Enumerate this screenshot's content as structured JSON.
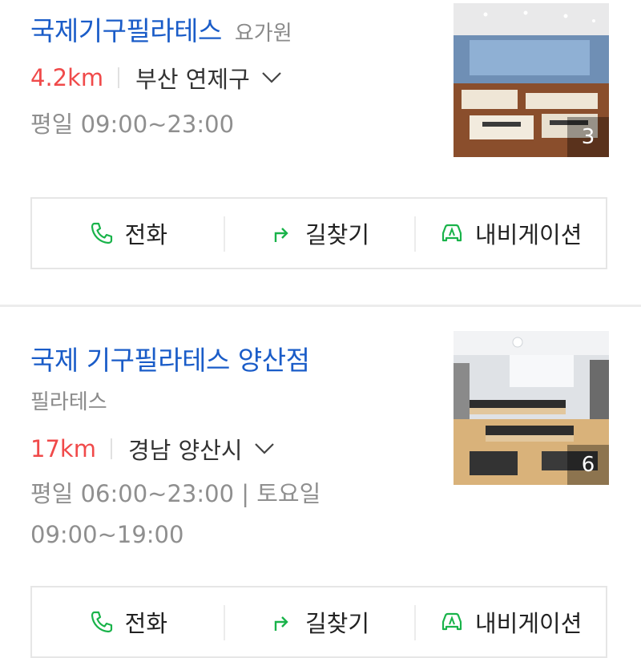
{
  "listings": [
    {
      "title": "국제기구필라테스",
      "category": "요가원",
      "distance": "4.2km",
      "region": "부산 연제구",
      "hours": "평일 09:00~23:00",
      "photo_count": "3"
    },
    {
      "title": "국제 기구필라테스 양산점",
      "category": "필라테스",
      "distance": "17km",
      "region": "경남 양산시",
      "hours": "평일 06:00~23:00 | 토요일 09:00~19:00",
      "photo_count": "6"
    }
  ],
  "actions": {
    "call": "전화",
    "directions": "길찾기",
    "navigation": "내비게이션"
  },
  "colors": {
    "title": "#1a5cc8",
    "distance": "#f04a4a",
    "action_icon": "#19b34a"
  },
  "icons": [
    "phone-icon",
    "directions-arrow-icon",
    "car-navigation-icon",
    "chevron-down-icon"
  ]
}
